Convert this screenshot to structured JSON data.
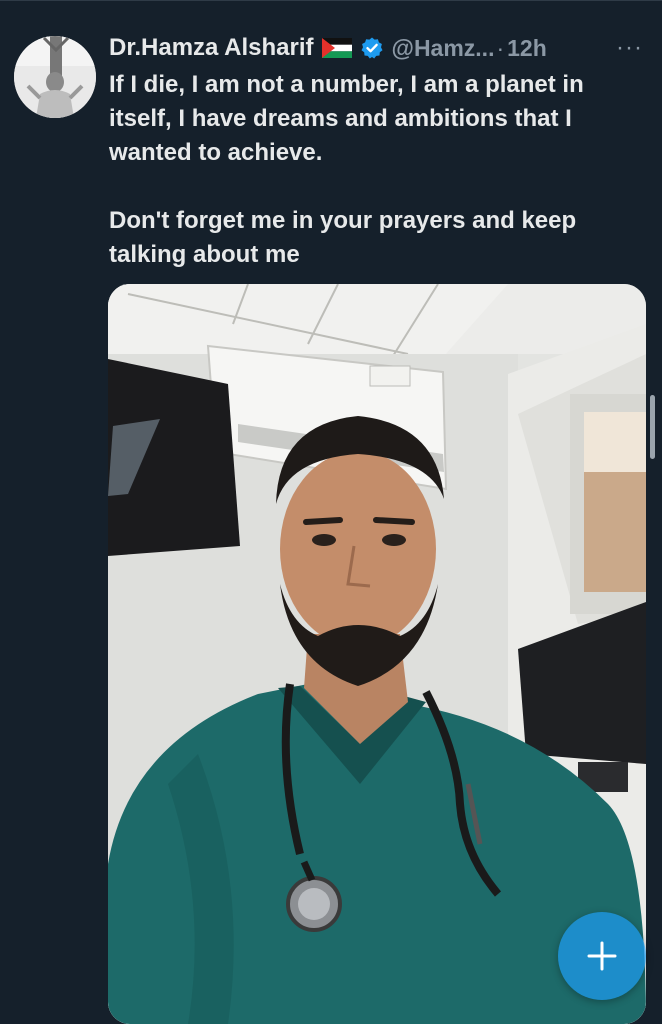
{
  "tweet": {
    "author_name": "Dr.Hamza Alsharif",
    "handle": "@Hamz...",
    "separator": "·",
    "time": "12h",
    "more_label": "···",
    "text_paragraph_1": "If I die, I am not a number, I am a planet in itself, I have dreams and ambitions that I wanted to achieve.",
    "text_paragraph_2": "Don't forget me in your prayers and keep talking about me"
  },
  "icons": {
    "flag": "palestine-flag-icon",
    "verified": "verified-badge-icon",
    "more": "more-options-icon",
    "compose": "plus-icon"
  },
  "colors": {
    "background": "#15202b",
    "primary_text": "#e7e9ea",
    "secondary_text": "#8b98a5",
    "verified_blue": "#1d9bf0",
    "scrubs_green": "#1e6b6a"
  }
}
